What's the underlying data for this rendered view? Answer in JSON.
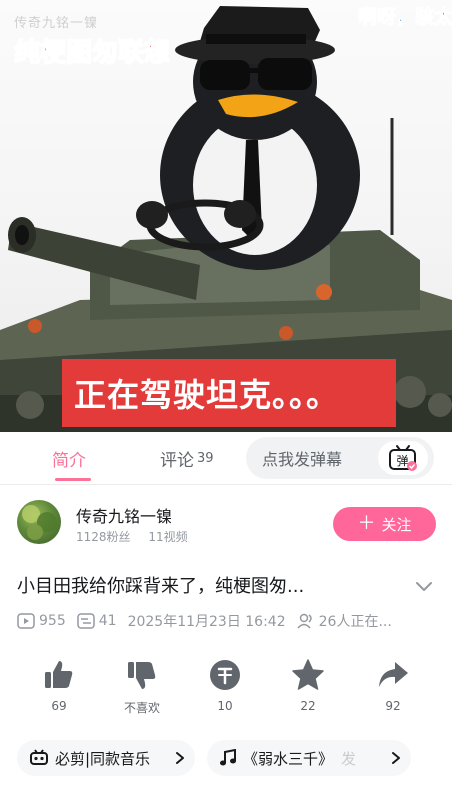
{
  "video": {
    "watermark": "传奇九铭一镍",
    "overlay_title": "纯梗图匆联想",
    "danmaku": "啊呀，骇太",
    "caption": "正在驾驶坦克。。。"
  },
  "tabs": {
    "intro": "简介",
    "comments": "评论",
    "comments_count": "39",
    "danmaku_placeholder": "点我发弹幕",
    "danmaku_toggle": "弹"
  },
  "uploader": {
    "name": "传奇九铭一镍",
    "fans": "1128粉丝",
    "videos": "11视频",
    "follow_label": "关注"
  },
  "video_info": {
    "title": "小目田我给你踩背来了，纯梗图匆...",
    "plays": "955",
    "danmaku_count": "41",
    "datetime": "2025年11月23日 16:42",
    "watching": "26人正在..."
  },
  "actions": {
    "like": "69",
    "dislike": "不喜欢",
    "coin": "10",
    "favorite": "22",
    "share": "92"
  },
  "chips": {
    "music": "必剪|同款音乐",
    "song": "《弱水三千》",
    "song_extra": "发"
  },
  "colors": {
    "accent_pink": "#fb7299",
    "follow_pink": "#ff6699",
    "caption_red": "#e33a3a"
  }
}
